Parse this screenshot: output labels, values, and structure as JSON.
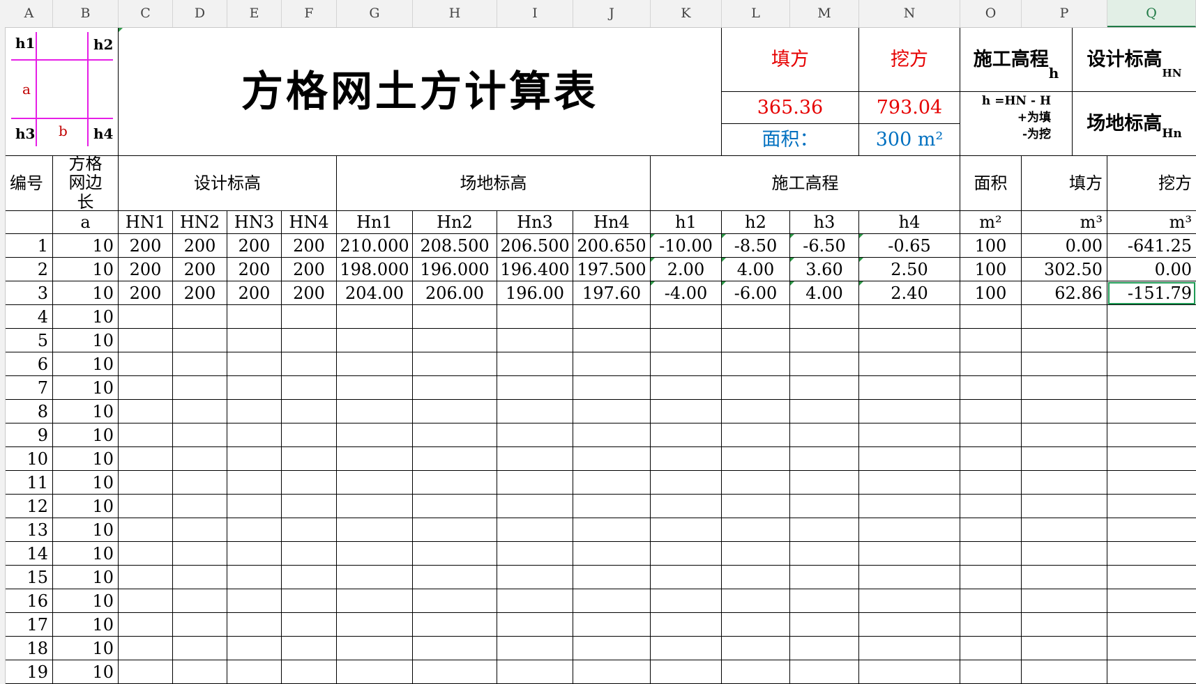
{
  "columns": [
    "A",
    "B",
    "C",
    "D",
    "E",
    "F",
    "G",
    "H",
    "I",
    "J",
    "K",
    "L",
    "M",
    "N",
    "O",
    "P",
    "Q"
  ],
  "selected_column": "Q",
  "title": "方格网土方计算表",
  "diagram": {
    "h1": "h1",
    "h2": "h2",
    "h3": "h3",
    "h4": "h4",
    "a": "a",
    "b": "b"
  },
  "summary": {
    "fill_label": "填方",
    "cut_label": "挖方",
    "fill_value": "365.36",
    "cut_value": "793.04",
    "area_label": "面积：",
    "area_value": "300 m²"
  },
  "legend": {
    "construction_height": "施工高程",
    "construction_sub": "h",
    "design_elev": "设计标高",
    "design_sub": "HN",
    "formula": "h =HN - H",
    "plus_fill": "+为填",
    "minus_cut": "-为挖",
    "site_elev": "场地标高",
    "site_sub": "Hn"
  },
  "headers": {
    "id": "编号",
    "grid_side": "方格网边长",
    "design": "设计标高",
    "site": "场地标高",
    "construction": "施工高程",
    "area": "面积",
    "fill": "填方",
    "cut": "挖方"
  },
  "subheaders": [
    "",
    "a",
    "HN1",
    "HN2",
    "HN3",
    "HN4",
    "Hn1",
    "Hn2",
    "Hn3",
    "Hn4",
    "h1",
    "h2",
    "h3",
    "h4",
    "m²",
    "m³",
    "m³"
  ],
  "rows": [
    [
      "1",
      "10",
      "200",
      "200",
      "200",
      "200",
      "210.000",
      "208.500",
      "206.500",
      "200.650",
      "-10.00",
      "-8.50",
      "-6.50",
      "-0.65",
      "100",
      "0.00",
      "-641.25"
    ],
    [
      "2",
      "10",
      "200",
      "200",
      "200",
      "200",
      "198.000",
      "196.000",
      "196.400",
      "197.500",
      "2.00",
      "4.00",
      "3.60",
      "2.50",
      "100",
      "302.50",
      "0.00"
    ],
    [
      "3",
      "10",
      "200",
      "200",
      "200",
      "200",
      "204.00",
      "206.00",
      "196.00",
      "197.60",
      "-4.00",
      "-6.00",
      "4.00",
      "2.40",
      "100",
      "62.86",
      "-151.79"
    ],
    [
      "4",
      "10",
      "",
      "",
      "",
      "",
      "",
      "",
      "",
      "",
      "",
      "",
      "",
      "",
      "",
      "",
      ""
    ],
    [
      "5",
      "10",
      "",
      "",
      "",
      "",
      "",
      "",
      "",
      "",
      "",
      "",
      "",
      "",
      "",
      "",
      ""
    ],
    [
      "6",
      "10",
      "",
      "",
      "",
      "",
      "",
      "",
      "",
      "",
      "",
      "",
      "",
      "",
      "",
      "",
      ""
    ],
    [
      "7",
      "10",
      "",
      "",
      "",
      "",
      "",
      "",
      "",
      "",
      "",
      "",
      "",
      "",
      "",
      "",
      ""
    ],
    [
      "8",
      "10",
      "",
      "",
      "",
      "",
      "",
      "",
      "",
      "",
      "",
      "",
      "",
      "",
      "",
      "",
      ""
    ],
    [
      "9",
      "10",
      "",
      "",
      "",
      "",
      "",
      "",
      "",
      "",
      "",
      "",
      "",
      "",
      "",
      "",
      ""
    ],
    [
      "10",
      "10",
      "",
      "",
      "",
      "",
      "",
      "",
      "",
      "",
      "",
      "",
      "",
      "",
      "",
      "",
      ""
    ],
    [
      "11",
      "10",
      "",
      "",
      "",
      "",
      "",
      "",
      "",
      "",
      "",
      "",
      "",
      "",
      "",
      "",
      ""
    ],
    [
      "12",
      "10",
      "",
      "",
      "",
      "",
      "",
      "",
      "",
      "",
      "",
      "",
      "",
      "",
      "",
      "",
      ""
    ],
    [
      "13",
      "10",
      "",
      "",
      "",
      "",
      "",
      "",
      "",
      "",
      "",
      "",
      "",
      "",
      "",
      "",
      ""
    ],
    [
      "14",
      "10",
      "",
      "",
      "",
      "",
      "",
      "",
      "",
      "",
      "",
      "",
      "",
      "",
      "",
      "",
      ""
    ],
    [
      "15",
      "10",
      "",
      "",
      "",
      "",
      "",
      "",
      "",
      "",
      "",
      "",
      "",
      "",
      "",
      "",
      ""
    ],
    [
      "16",
      "10",
      "",
      "",
      "",
      "",
      "",
      "",
      "",
      "",
      "",
      "",
      "",
      "",
      "",
      "",
      ""
    ],
    [
      "17",
      "10",
      "",
      "",
      "",
      "",
      "",
      "",
      "",
      "",
      "",
      "",
      "",
      "",
      "",
      "",
      ""
    ],
    [
      "18",
      "10",
      "",
      "",
      "",
      "",
      "",
      "",
      "",
      "",
      "",
      "",
      "",
      "",
      "",
      "",
      ""
    ],
    [
      "19",
      "10",
      "",
      "",
      "",
      "",
      "",
      "",
      "",
      "",
      "",
      "",
      "",
      "",
      "",
      "",
      ""
    ]
  ],
  "colors": {
    "accent_green": "#1f9a55",
    "fill_red": "#e60000",
    "area_blue": "#0070c0",
    "diagram_magenta": "#e61ee6"
  }
}
